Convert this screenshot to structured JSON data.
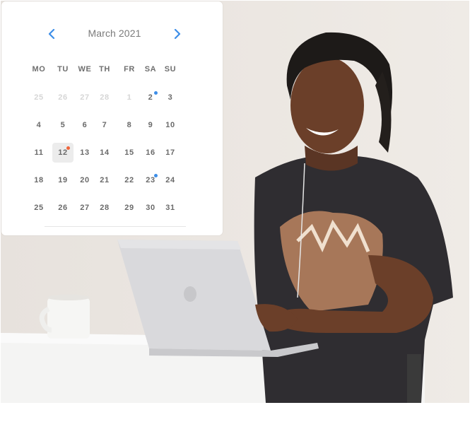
{
  "calendar": {
    "month_label": "March 2021",
    "prev_icon": "chevron-left-icon",
    "next_icon": "chevron-right-icon",
    "accent_color": "#3d8ee8",
    "weekdays": [
      "MO",
      "TU",
      "WE",
      "TH",
      "FR",
      "SA",
      "SU"
    ],
    "weeks": [
      [
        {
          "label": "25",
          "muted": true
        },
        {
          "label": "26",
          "muted": true
        },
        {
          "label": "27",
          "muted": true
        },
        {
          "label": "28",
          "muted": true
        },
        {
          "label": "1",
          "muted": true
        },
        {
          "label": "2",
          "event": "blue"
        },
        {
          "label": "3"
        }
      ],
      [
        {
          "label": "4"
        },
        {
          "label": "5"
        },
        {
          "label": "6"
        },
        {
          "label": "7"
        },
        {
          "label": "8"
        },
        {
          "label": "9"
        },
        {
          "label": "10"
        }
      ],
      [
        {
          "label": "11"
        },
        {
          "label": "12",
          "selected": true,
          "event": "orange"
        },
        {
          "label": "13"
        },
        {
          "label": "14"
        },
        {
          "label": "15"
        },
        {
          "label": "16"
        },
        {
          "label": "17"
        }
      ],
      [
        {
          "label": "18"
        },
        {
          "label": "19"
        },
        {
          "label": "20"
        },
        {
          "label": "21"
        },
        {
          "label": "22"
        },
        {
          "label": "23",
          "event": "blue"
        },
        {
          "label": "24"
        }
      ],
      [
        {
          "label": "25"
        },
        {
          "label": "26"
        },
        {
          "label": "27"
        },
        {
          "label": "28"
        },
        {
          "label": "29"
        },
        {
          "label": "30"
        },
        {
          "label": "31"
        }
      ]
    ],
    "event_colors": {
      "blue": "#3d8ee8",
      "orange": "#f0643a"
    }
  }
}
